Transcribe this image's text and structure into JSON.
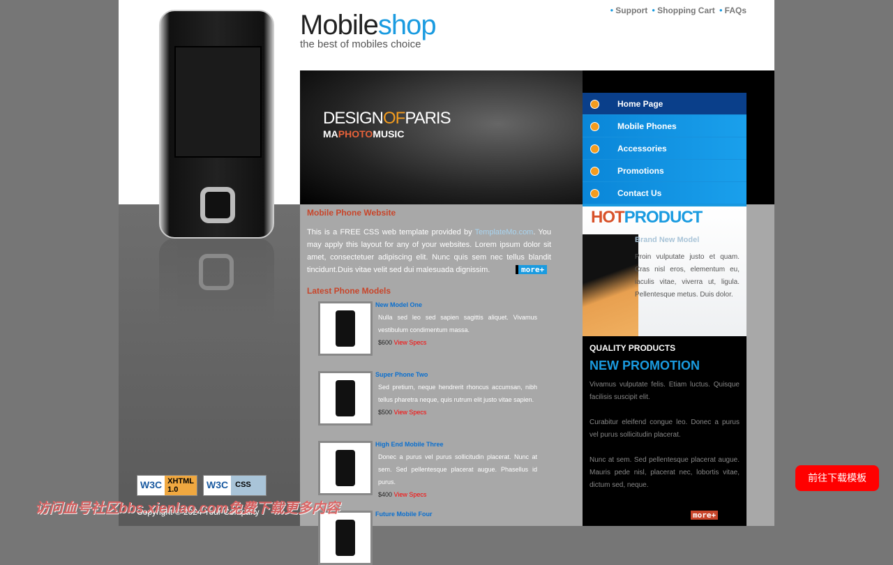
{
  "header": {
    "logo_main": "Mobile",
    "logo_accent": "shop",
    "tagline": "the best of mobiles choice",
    "links": [
      "Support",
      "Shopping Cart",
      "FAQs"
    ]
  },
  "banner": {
    "line1a": "DESIGN",
    "line1b": "OF",
    "line1c": "PARIS",
    "line2a": "MA",
    "line2b": "PHOTO",
    "line2c": "MUSIC"
  },
  "menu": [
    {
      "label": "Home Page",
      "active": true
    },
    {
      "label": "Mobile Phones"
    },
    {
      "label": "Accessories"
    },
    {
      "label": "Promotions"
    },
    {
      "label": "Contact Us"
    }
  ],
  "main": {
    "title": "Mobile Phone Website",
    "intro_pre": "This is a FREE CSS web template provided by ",
    "intro_link": "TemplateMo.com",
    "intro_post": ". You may apply this layout for any of your websites. Lorem ipsum dolor sit amet, consectetuer adipiscing elit. Nunc quis sem nec tellus blandit tincidunt.Duis vitae velit sed dui malesuada dignissim.",
    "more": "more+",
    "latest_title": "Latest Phone Models",
    "products": [
      {
        "name": "New Model One",
        "desc": "Nulla sed leo sed sapien sagittis aliquet. Vivamus vestibulum condimentum massa.",
        "price": "$600",
        "link": "View Specs"
      },
      {
        "name": "Super Phone Two",
        "desc": "Sed pretium, neque hendrerit rhoncus accumsan, nibh tellus pharetra neque, quis rutrum elit justo vitae sapien.",
        "price": "$500",
        "link": "View Specs"
      },
      {
        "name": "High End Mobile Three",
        "desc": "Donec a purus vel purus sollicitudin placerat. Nunc at sem. Sed pellentesque placerat augue. Phasellus id purus.",
        "price": "$400",
        "link": "View Specs"
      },
      {
        "name": "Future Mobile Four",
        "desc": "",
        "price": "",
        "link": ""
      }
    ]
  },
  "hot": {
    "title_a": "HOT",
    "title_b": "PRODUCT",
    "subtitle": "Brand New Model",
    "desc": "Proin vulputate justo et quam. Cras nisl eros, elementum eu, iaculis vitae, viverra ut, ligula. Pellentesque metus. Duis dolor."
  },
  "promo": {
    "heading": "QUALITY PRODUCTS",
    "title": "NEW PROMOTION",
    "p1": "Vivamus vulputate felis. Etiam luctus. Quisque facilisis suscipit elit.",
    "p2": "Curabitur eleifend congue leo. Donec a purus vel purus sollicitudin placerat.",
    "p3": "Nunc at sem. Sed pellentesque placerat augue. Mauris pede nisl, placerat nec, lobortis vitae, dictum sed, neque.",
    "more": "more+"
  },
  "footer": {
    "badge1_w3c": "W3C",
    "badge1_a": "XHTML",
    "badge1_b": "1.0",
    "badge2_w3c": "W3C",
    "badge2_a": "CSS",
    "copyright": "Copyright © 2024 Your Company"
  },
  "watermark": "访问血号社区bbs.xienlao.com免费下载更多内容",
  "download_button": "前往下载模板"
}
